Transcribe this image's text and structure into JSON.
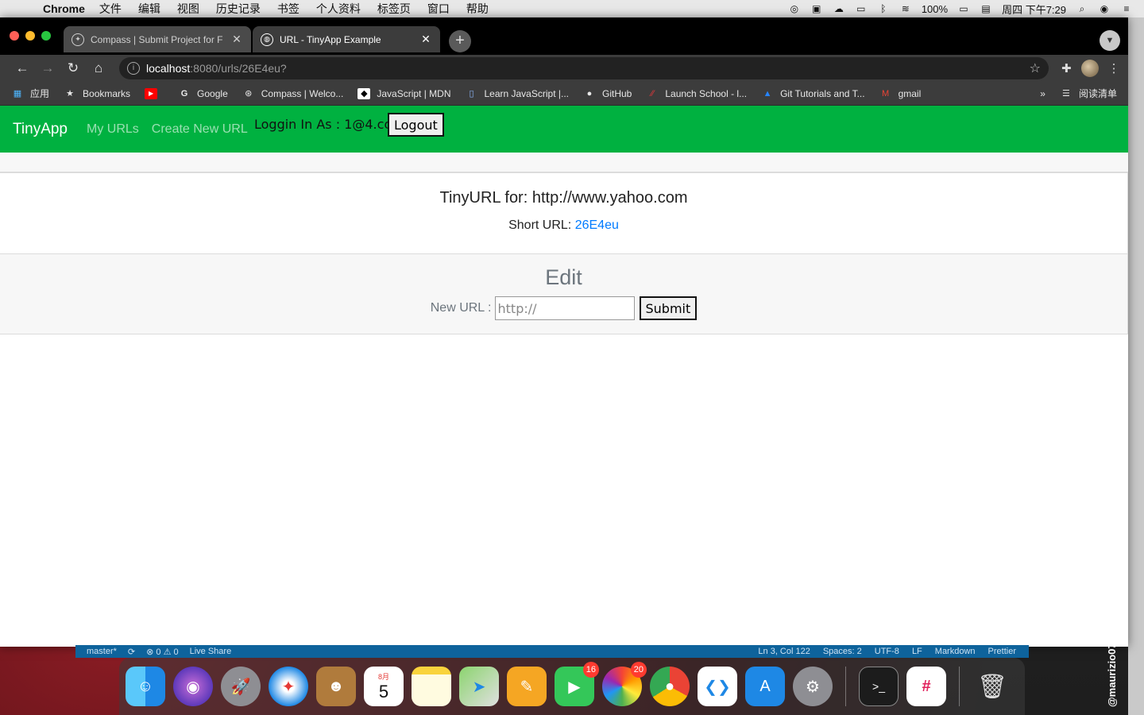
{
  "menubar": {
    "app_name": "Chrome",
    "menus": [
      "文件",
      "编辑",
      "视图",
      "历史记录",
      "书签",
      "个人资料",
      "标签页",
      "窗口",
      "帮助"
    ],
    "battery": "100%",
    "clock": "周四 下午7:29"
  },
  "tabs": [
    {
      "title": "Compass | Submit Project for F",
      "active": false
    },
    {
      "title": "URL - TinyApp Example",
      "active": true
    }
  ],
  "omnibox": {
    "host": "localhost",
    "path": ":8080/urls/26E4eu?"
  },
  "bookmarks": [
    {
      "label": "应用",
      "icon": "apps-grid-icon"
    },
    {
      "label": "Bookmarks",
      "icon": "star-icon"
    },
    {
      "label": "",
      "icon": "youtube-icon"
    },
    {
      "label": "Google",
      "icon": "google-icon"
    },
    {
      "label": "Compass | Welco...",
      "icon": "compass-icon"
    },
    {
      "label": "JavaScript | MDN",
      "icon": "mdn-icon"
    },
    {
      "label": "Learn JavaScript |...",
      "icon": "learn-js-icon"
    },
    {
      "label": "GitHub",
      "icon": "github-icon"
    },
    {
      "label": "Launch School - l...",
      "icon": "launch-school-icon"
    },
    {
      "label": "Git Tutorials and T...",
      "icon": "atlassian-icon"
    },
    {
      "label": "gmail",
      "icon": "gmail-icon"
    }
  ],
  "reading_list": "阅读清单",
  "app": {
    "brand": "TinyApp",
    "nav_my_urls": "My URLs",
    "nav_create": "Create New URL",
    "login_text": "Loggin In As : 1@4.com",
    "logout": "Logout",
    "card_title": "TinyURL for: http://www.yahoo.com",
    "short_url_label": "Short URL: ",
    "short_url": "26E4eu",
    "edit_title": "Edit",
    "new_url_label": "New URL :",
    "new_url_placeholder": "http://",
    "submit": "Submit"
  },
  "vscode": {
    "branch": "master*",
    "problems": "⊗ 0 ⚠ 0",
    "live_share": "Live Share",
    "position": "Ln 3, Col 122",
    "spaces": "Spaces: 2",
    "encoding": "UTF-8",
    "eol": "LF",
    "language": "Markdown",
    "prettier": "Prettier"
  },
  "dock": {
    "calendar_month": "8月",
    "calendar_day": "5",
    "facetime_badge": "16",
    "photos_badge": "20"
  },
  "watermark": "@maurizio07"
}
